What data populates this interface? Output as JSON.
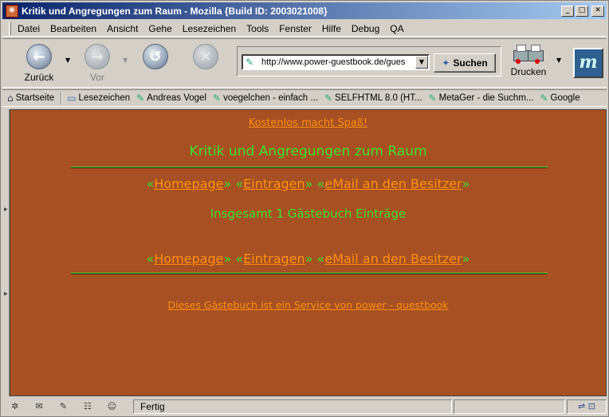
{
  "window": {
    "title": "Kritik und Angregungen zum Raum - Mozilla {Build ID: 2003021008}",
    "app_icon": "mozilla-icon",
    "controls": {
      "minimize": "_",
      "maximize": "□",
      "close": "✕"
    }
  },
  "menubar": {
    "items": [
      "Datei",
      "Bearbeiten",
      "Ansicht",
      "Gehe",
      "Lesezeichen",
      "Tools",
      "Fenster",
      "Hilfe",
      "Debug",
      "QA"
    ]
  },
  "navbar": {
    "back_label": "Zurück",
    "forward_label": "Vor",
    "url": "http://www.power-guestbook.de/gues",
    "search_label": "Suchen",
    "print_label": "Drucken",
    "brand_letter": "m"
  },
  "bookmarks": {
    "home": "Startseite",
    "folder": "Lesezeichen",
    "items": [
      "Andreas Vogel",
      "voegelchen - einfach ...",
      "SELFHTML 8.0 (HT...",
      "MetaGer - die Suchm...",
      "Google"
    ]
  },
  "content": {
    "top_link": "Kostenlos macht Spaß!",
    "title": "Kritik und Angregungen zum Raum",
    "nav": {
      "open": "«",
      "close": "»",
      "homepage": "Homepage",
      "eintragen": "Eintragen",
      "email": "eMail an den Besitzer"
    },
    "count": "Insgesamt 1 Gästebuch Einträge",
    "service": "Dieses Gästebuch ist ein Service von power - questbook"
  },
  "statusbar": {
    "text": "Fertig"
  },
  "colors": {
    "page_bg": "#a65023",
    "text_green": "#40e030",
    "link_orange": "#ff9010"
  }
}
